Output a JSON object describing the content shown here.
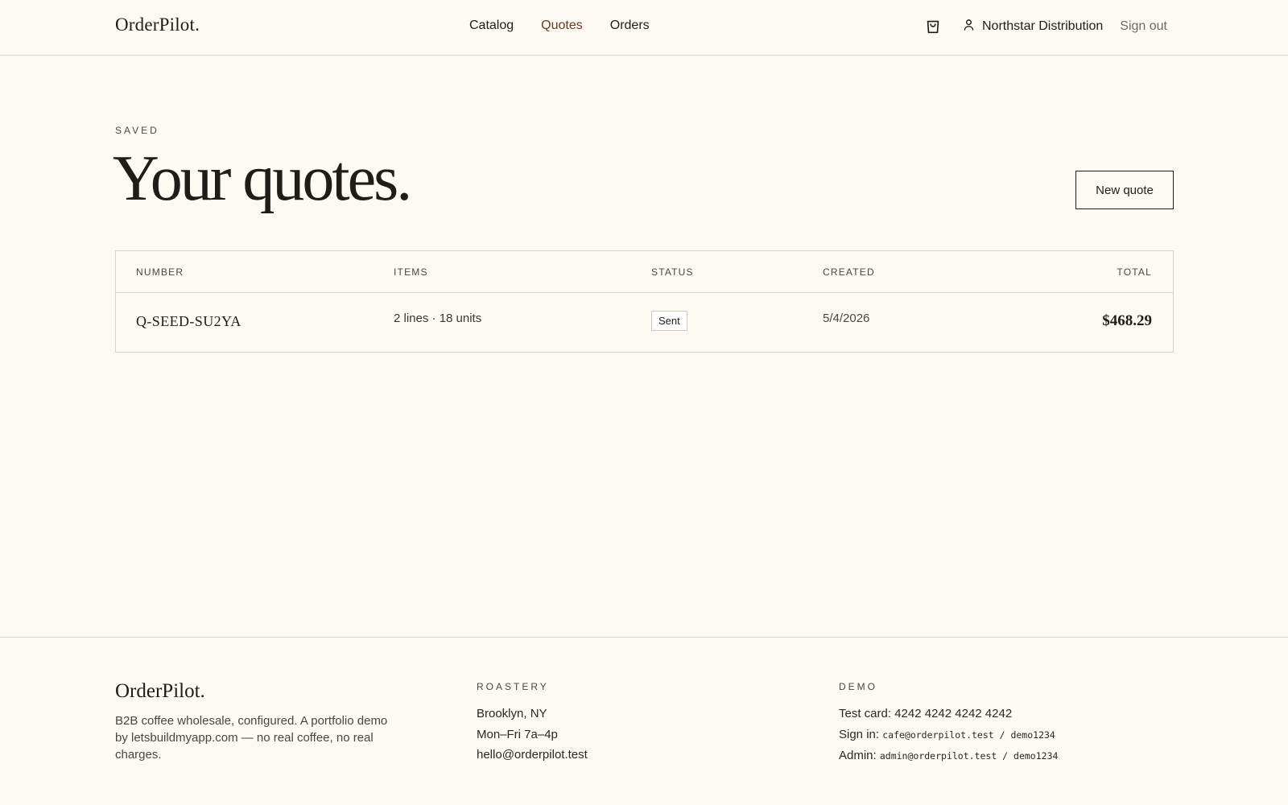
{
  "header": {
    "brand": "OrderPilot.",
    "nav": [
      {
        "label": "Catalog",
        "active": false
      },
      {
        "label": "Quotes",
        "active": true
      },
      {
        "label": "Orders",
        "active": false
      }
    ],
    "cart_icon": "shopping-bag-icon",
    "user_icon": "user-icon",
    "user_name": "Northstar Distribution",
    "sign_out": "Sign out"
  },
  "page": {
    "eyebrow": "SAVED",
    "title": "Your quotes.",
    "new_quote_label": "New quote"
  },
  "table": {
    "columns": [
      "NUMBER",
      "ITEMS",
      "STATUS",
      "CREATED",
      "TOTAL"
    ],
    "rows": [
      {
        "number": "Q-SEED-SU2YA",
        "items": "2 lines · 18 units",
        "status": "Sent",
        "created": "5/4/2026",
        "total": "$468.29"
      }
    ]
  },
  "footer": {
    "brand": "OrderPilot.",
    "tagline": "B2B coffee wholesale, configured. A portfolio demo by letsbuildmyapp.com — no real coffee, no real charges.",
    "roastery": {
      "heading": "ROASTERY",
      "lines": [
        "Brooklyn, NY",
        "Mon–Fri 7a–4p",
        "hello@orderpilot.test"
      ]
    },
    "demo": {
      "heading": "DEMO",
      "test_card": "Test card: 4242 4242 4242 4242",
      "sign_in_label": "Sign in:",
      "sign_in_value": "cafe@orderpilot.test / demo1234",
      "admin_label": "Admin:",
      "admin_value": "admin@orderpilot.test / demo1234"
    }
  },
  "colors": {
    "background": "#fcfaf2",
    "text": "#1f1d1a",
    "accent_active_nav": "#6b3a22",
    "border": "#d6d3cb"
  }
}
